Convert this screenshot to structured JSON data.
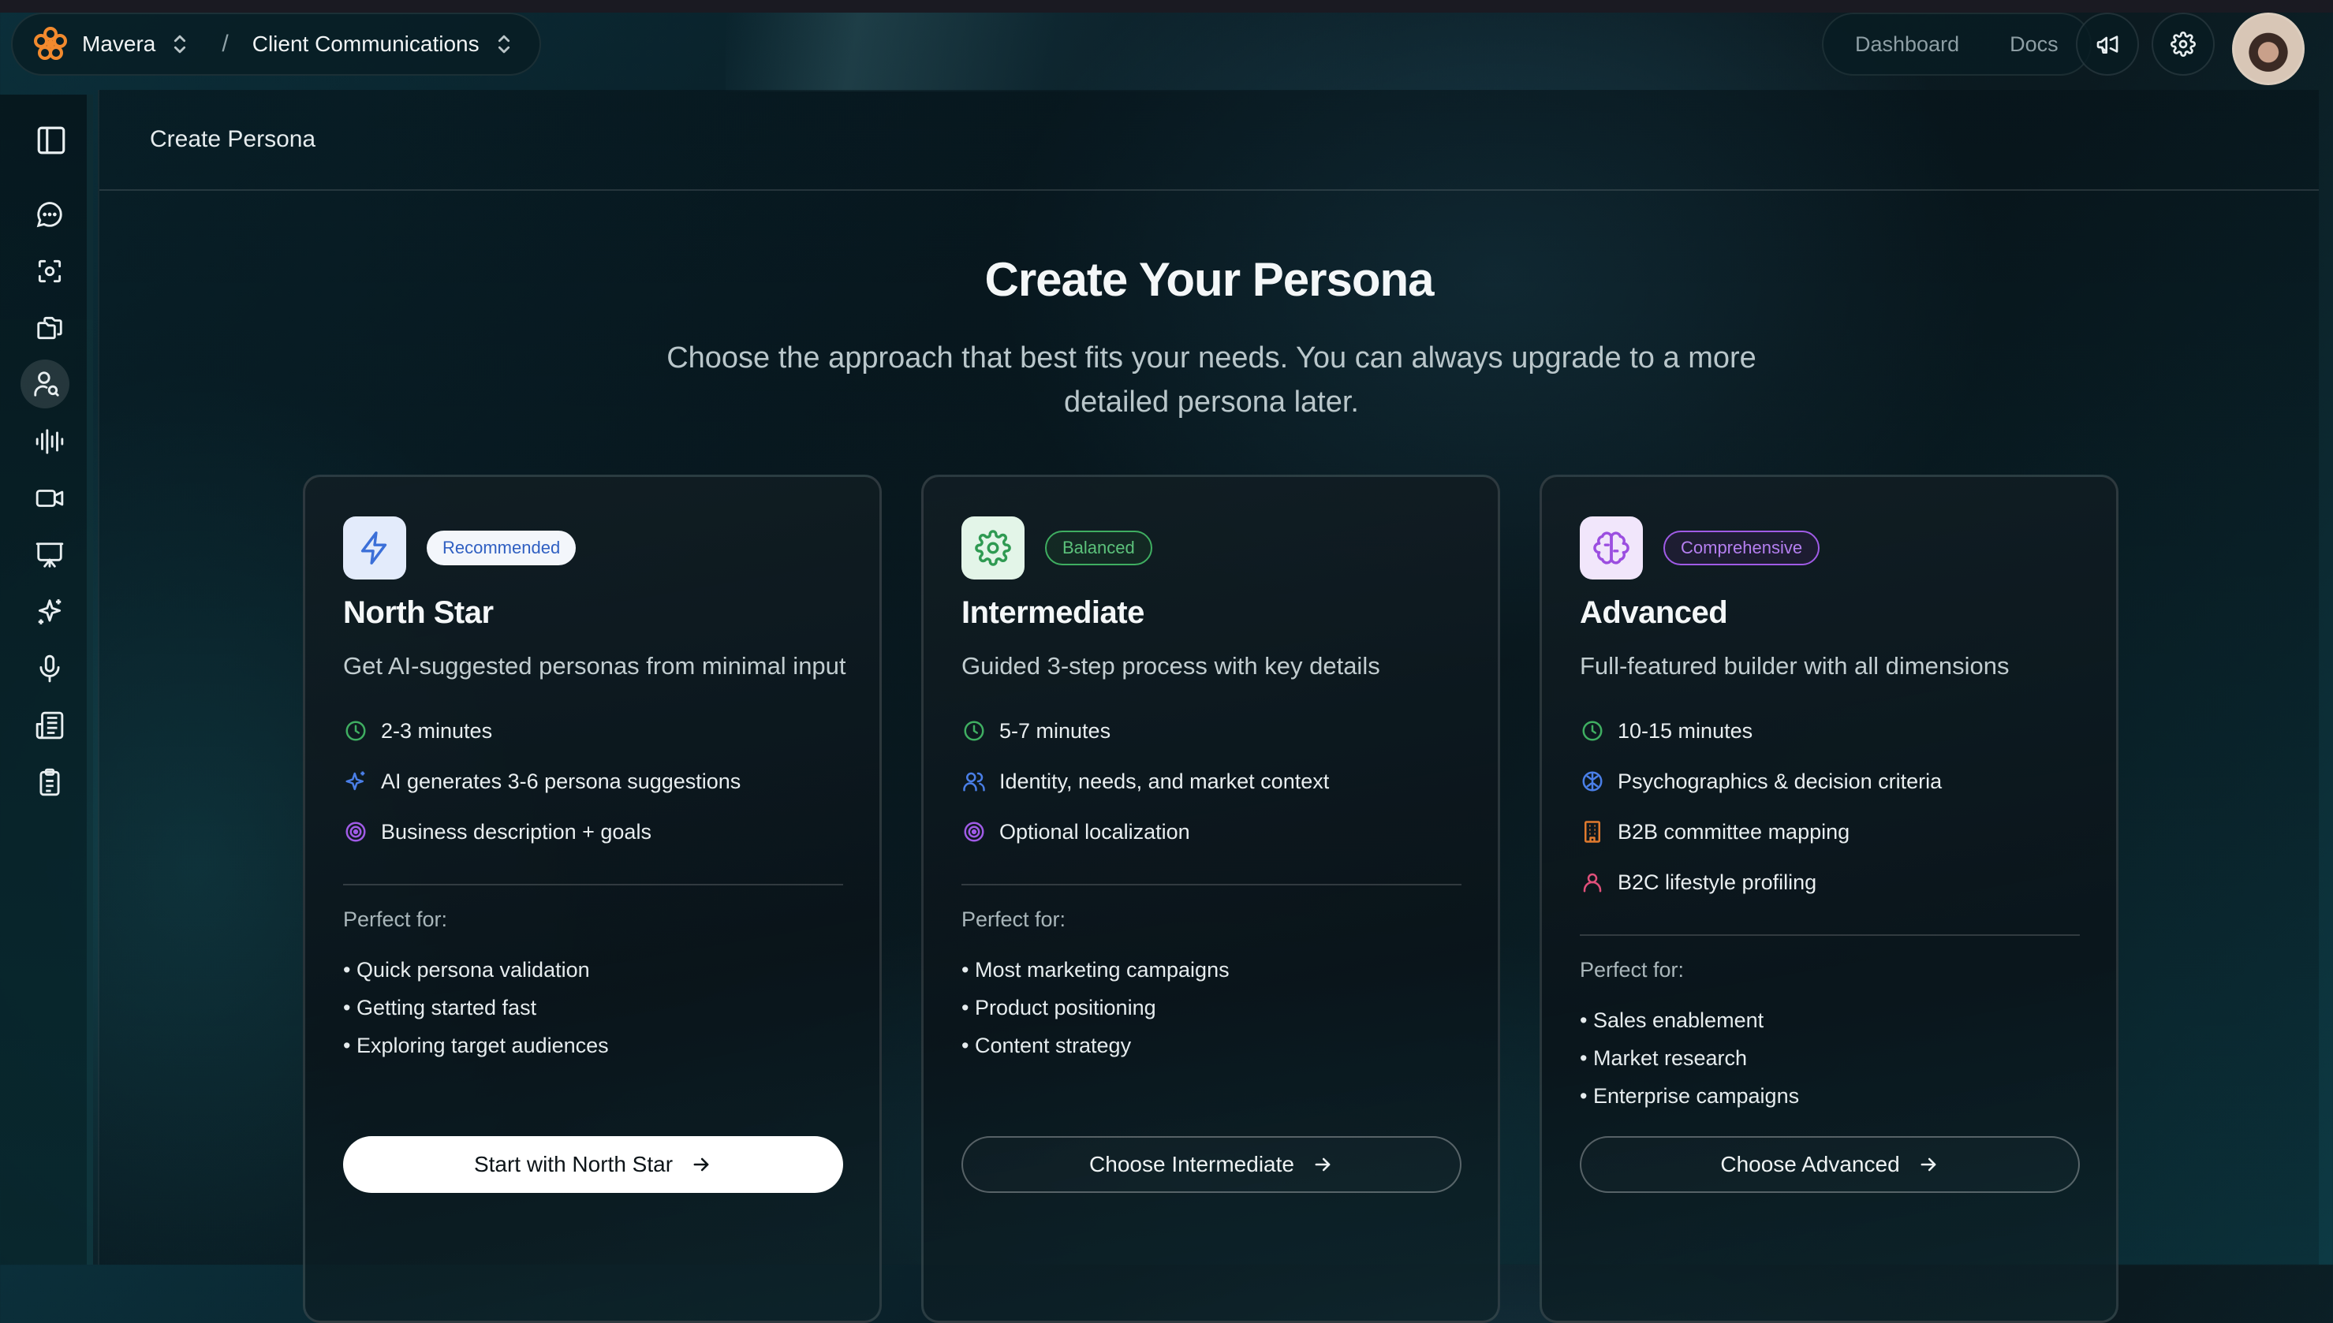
{
  "topbar": {
    "workspace": "Mavera",
    "project": "Client Communications",
    "separator": "/",
    "nav_links": [
      "Dashboard",
      "Docs"
    ],
    "icons": [
      "megaphone-icon",
      "gear-icon"
    ]
  },
  "sidebar": {
    "items": [
      {
        "icon": "panel-toggle-icon"
      },
      {
        "icon": "chat-icon"
      },
      {
        "icon": "focus-scan-icon"
      },
      {
        "icon": "files-icon"
      },
      {
        "icon": "persona-search-icon",
        "active": true
      },
      {
        "icon": "audio-wave-icon"
      },
      {
        "icon": "video-icon"
      },
      {
        "icon": "presentation-icon"
      },
      {
        "icon": "sparkles-icon"
      },
      {
        "icon": "microphone-icon"
      },
      {
        "icon": "news-icon"
      },
      {
        "icon": "clipboard-icon"
      }
    ]
  },
  "page": {
    "header": "Create Persona",
    "title": "Create Your Persona",
    "subtitle": "Choose the approach that best fits your needs. You can always upgrade to a more detailed persona later."
  },
  "cards": [
    {
      "badge": "Recommended",
      "name": "North Star",
      "description": "Get AI-suggested personas from minimal input",
      "features": [
        "2-3 minutes",
        "AI generates 3-6 persona suggestions",
        "Business description + goals"
      ],
      "perfect_label": "Perfect for:",
      "perfect_for": [
        "• Quick persona validation",
        "• Getting started fast",
        "• Exploring target audiences"
      ],
      "cta": "Start with North Star",
      "accent": "#3b6fd8"
    },
    {
      "badge": "Balanced",
      "name": "Intermediate",
      "description": "Guided 3-step process with key details",
      "features": [
        "5-7 minutes",
        "Identity, needs, and market context",
        "Optional localization"
      ],
      "perfect_label": "Perfect for:",
      "perfect_for": [
        "• Most marketing campaigns",
        "• Product positioning",
        "• Content strategy"
      ],
      "cta": "Choose Intermediate",
      "accent": "#2f9a52"
    },
    {
      "badge": "Comprehensive",
      "name": "Advanced",
      "description": "Full-featured builder with all dimensions",
      "features": [
        "10-15 minutes",
        "Psychographics & decision criteria",
        "B2B committee mapping",
        "B2C lifestyle profiling"
      ],
      "perfect_label": "Perfect for:",
      "perfect_for": [
        "• Sales enablement",
        "• Market research",
        "• Enterprise campaigns"
      ],
      "cta": "Choose Advanced",
      "accent": "#9b4ee0"
    }
  ]
}
